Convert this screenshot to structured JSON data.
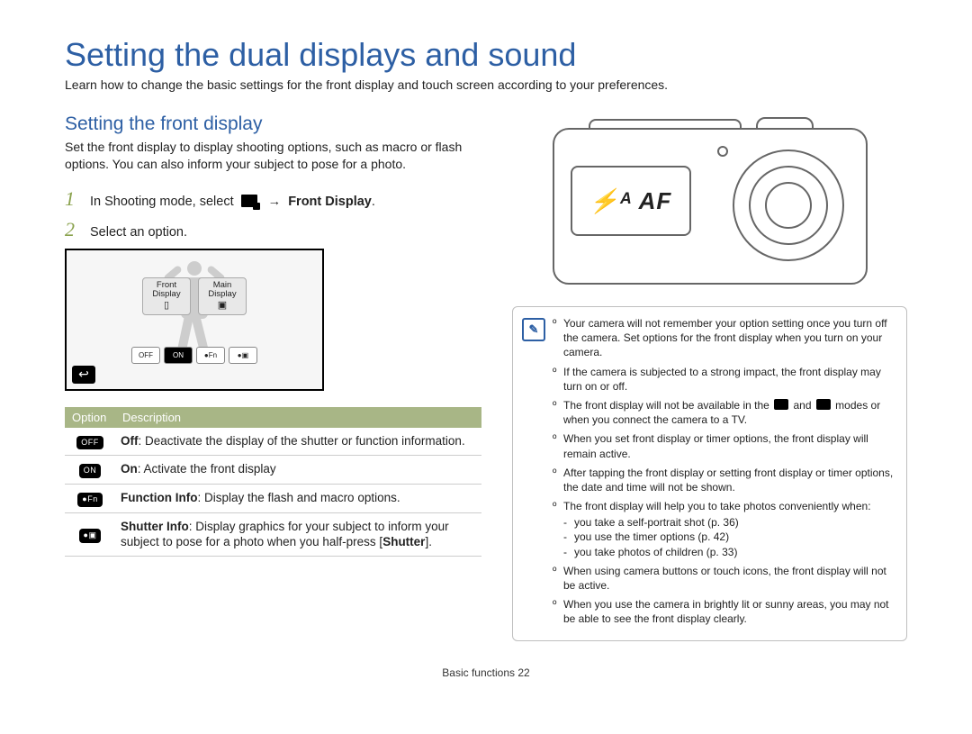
{
  "title": "Setting the dual displays and sound",
  "intro": "Learn how to change the basic settings for the front display and touch screen according to your preferences.",
  "subhead": "Setting the front display",
  "para1": "Set the front display to display shooting options, such as macro or ﬂash options. You can also inform your subject to pose for a photo.",
  "steps": {
    "s1_a": "In Shooting mode, select",
    "s1_b": "Front Display",
    "s1_end": ".",
    "s2": "Select an option."
  },
  "screenshot": {
    "label_front_a": "Front",
    "label_front_b": "Display",
    "label_main_a": "Main",
    "label_main_b": "Display",
    "btns": [
      "OFF",
      "ON",
      "●Fn",
      "●▣"
    ]
  },
  "options_table": {
    "headers": [
      "Option",
      "Description"
    ],
    "rows": [
      {
        "icon": "OFF",
        "label": "Off",
        "text": ": Deactivate the display of the shutter or function information."
      },
      {
        "icon": "ON",
        "label": "On",
        "text": ": Activate the front display"
      },
      {
        "icon": "●Fn",
        "label": "Function Info",
        "text": ": Display the ﬂash and macro options."
      },
      {
        "icon": "●▣",
        "label": "Shutter Info",
        "text": ": Display graphics for your subject to inform your subject to pose for a photo when you half-press [",
        "bold2": "Shutter",
        "tail": "]."
      }
    ]
  },
  "camera_screen": "⚡ᴬ AF",
  "notes": [
    "Your camera will not remember your option setting once you turn off the camera. Set options for the front display when you turn on your camera.",
    "If the camera is subjected to a strong impact, the front display may turn on or off.",
    "The front display will not be available in the  and  modes or when you connect the camera to a TV.",
    "When you set front display or timer options, the front display will remain active.",
    "After tapping the front display or setting front display or timer options, the date and time will not be shown.",
    "The front display will help you to take photos conveniently when:"
  ],
  "notes_sub": [
    "you take a self-portrait shot (p. 36)",
    "you use the timer options (p. 42)",
    "you take photos of children (p. 33)"
  ],
  "notes_tail": [
    "When using camera buttons or touch icons, the front display will not be active.",
    "When you use the camera in brightly lit or sunny areas, you may not be able to see the front display clearly."
  ],
  "footer_a": "Basic functions",
  "footer_b": "22"
}
